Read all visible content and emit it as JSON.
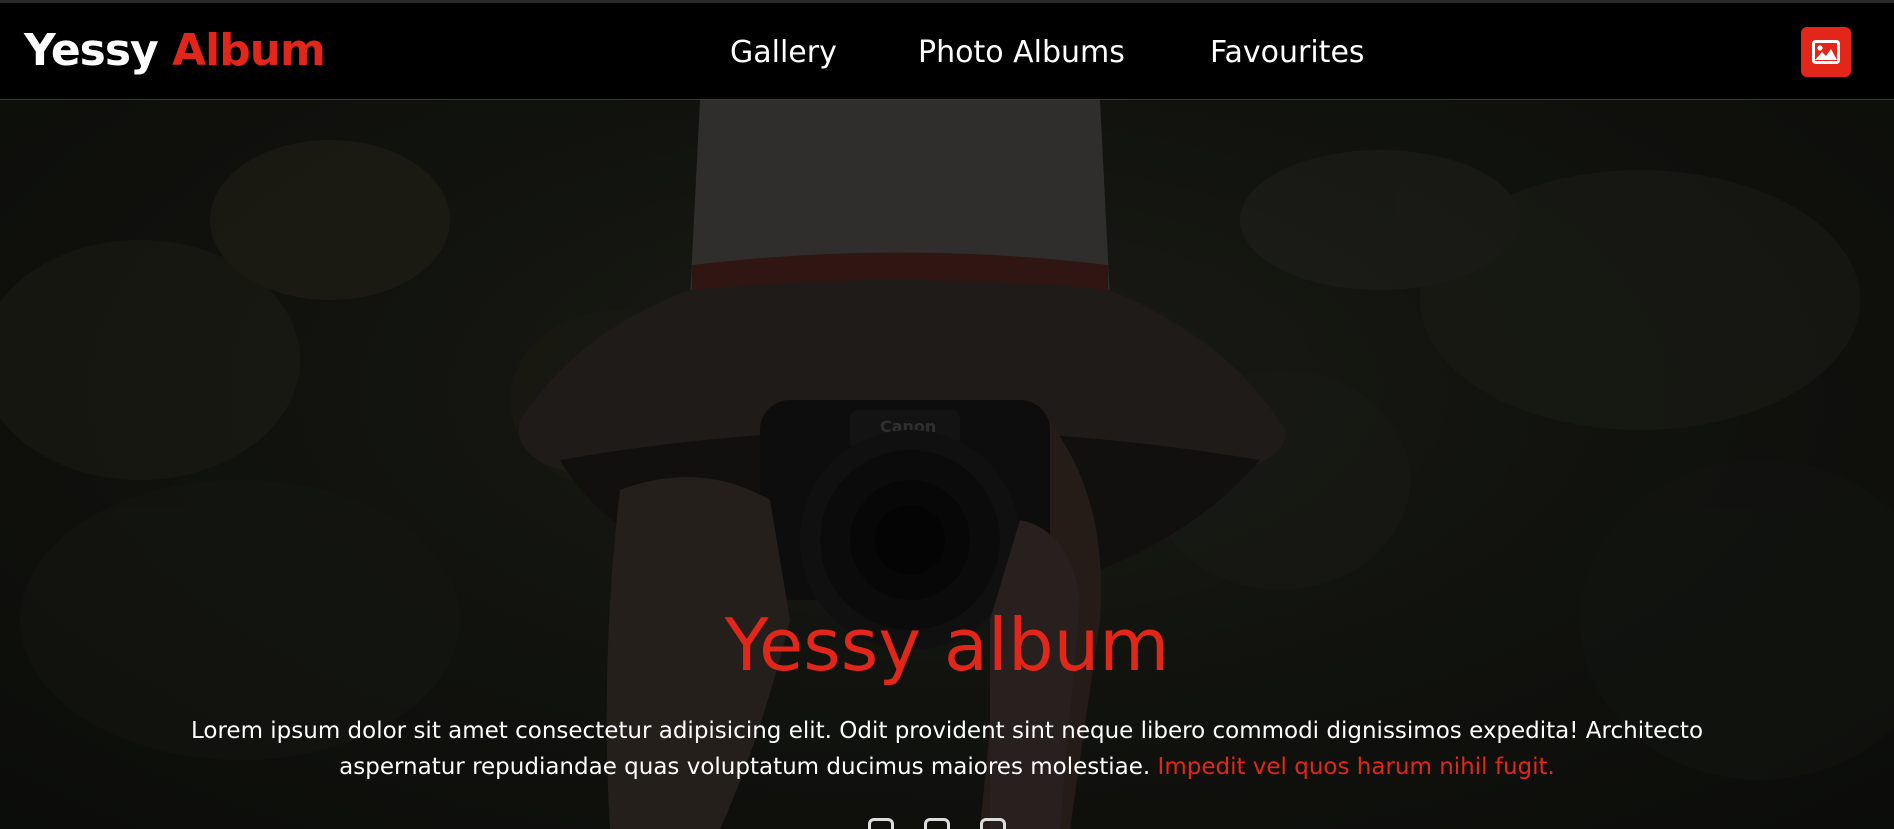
{
  "logo": {
    "part1": "Yessy",
    "part2": "Album"
  },
  "nav": {
    "items": [
      {
        "label": "Gallery"
      },
      {
        "label": "Photo Albums"
      },
      {
        "label": "Favourites"
      }
    ]
  },
  "header_button": {
    "icon": "image-icon"
  },
  "hero": {
    "background": "photographer-with-camera-photo",
    "title": "Yessy album",
    "text_main": "Lorem ipsum dolor sit amet consectetur adipisicing elit. Odit provident sint neque libero commodi dignissimos expedita! Architecto aspernatur repudiandae quas voluptatum ducimus maiores molestiae.",
    "text_highlight": "Impedit vel quos harum nihil fugit."
  },
  "colors": {
    "accent": "#e3261a",
    "background": "#000000",
    "text": "#ffffff"
  }
}
